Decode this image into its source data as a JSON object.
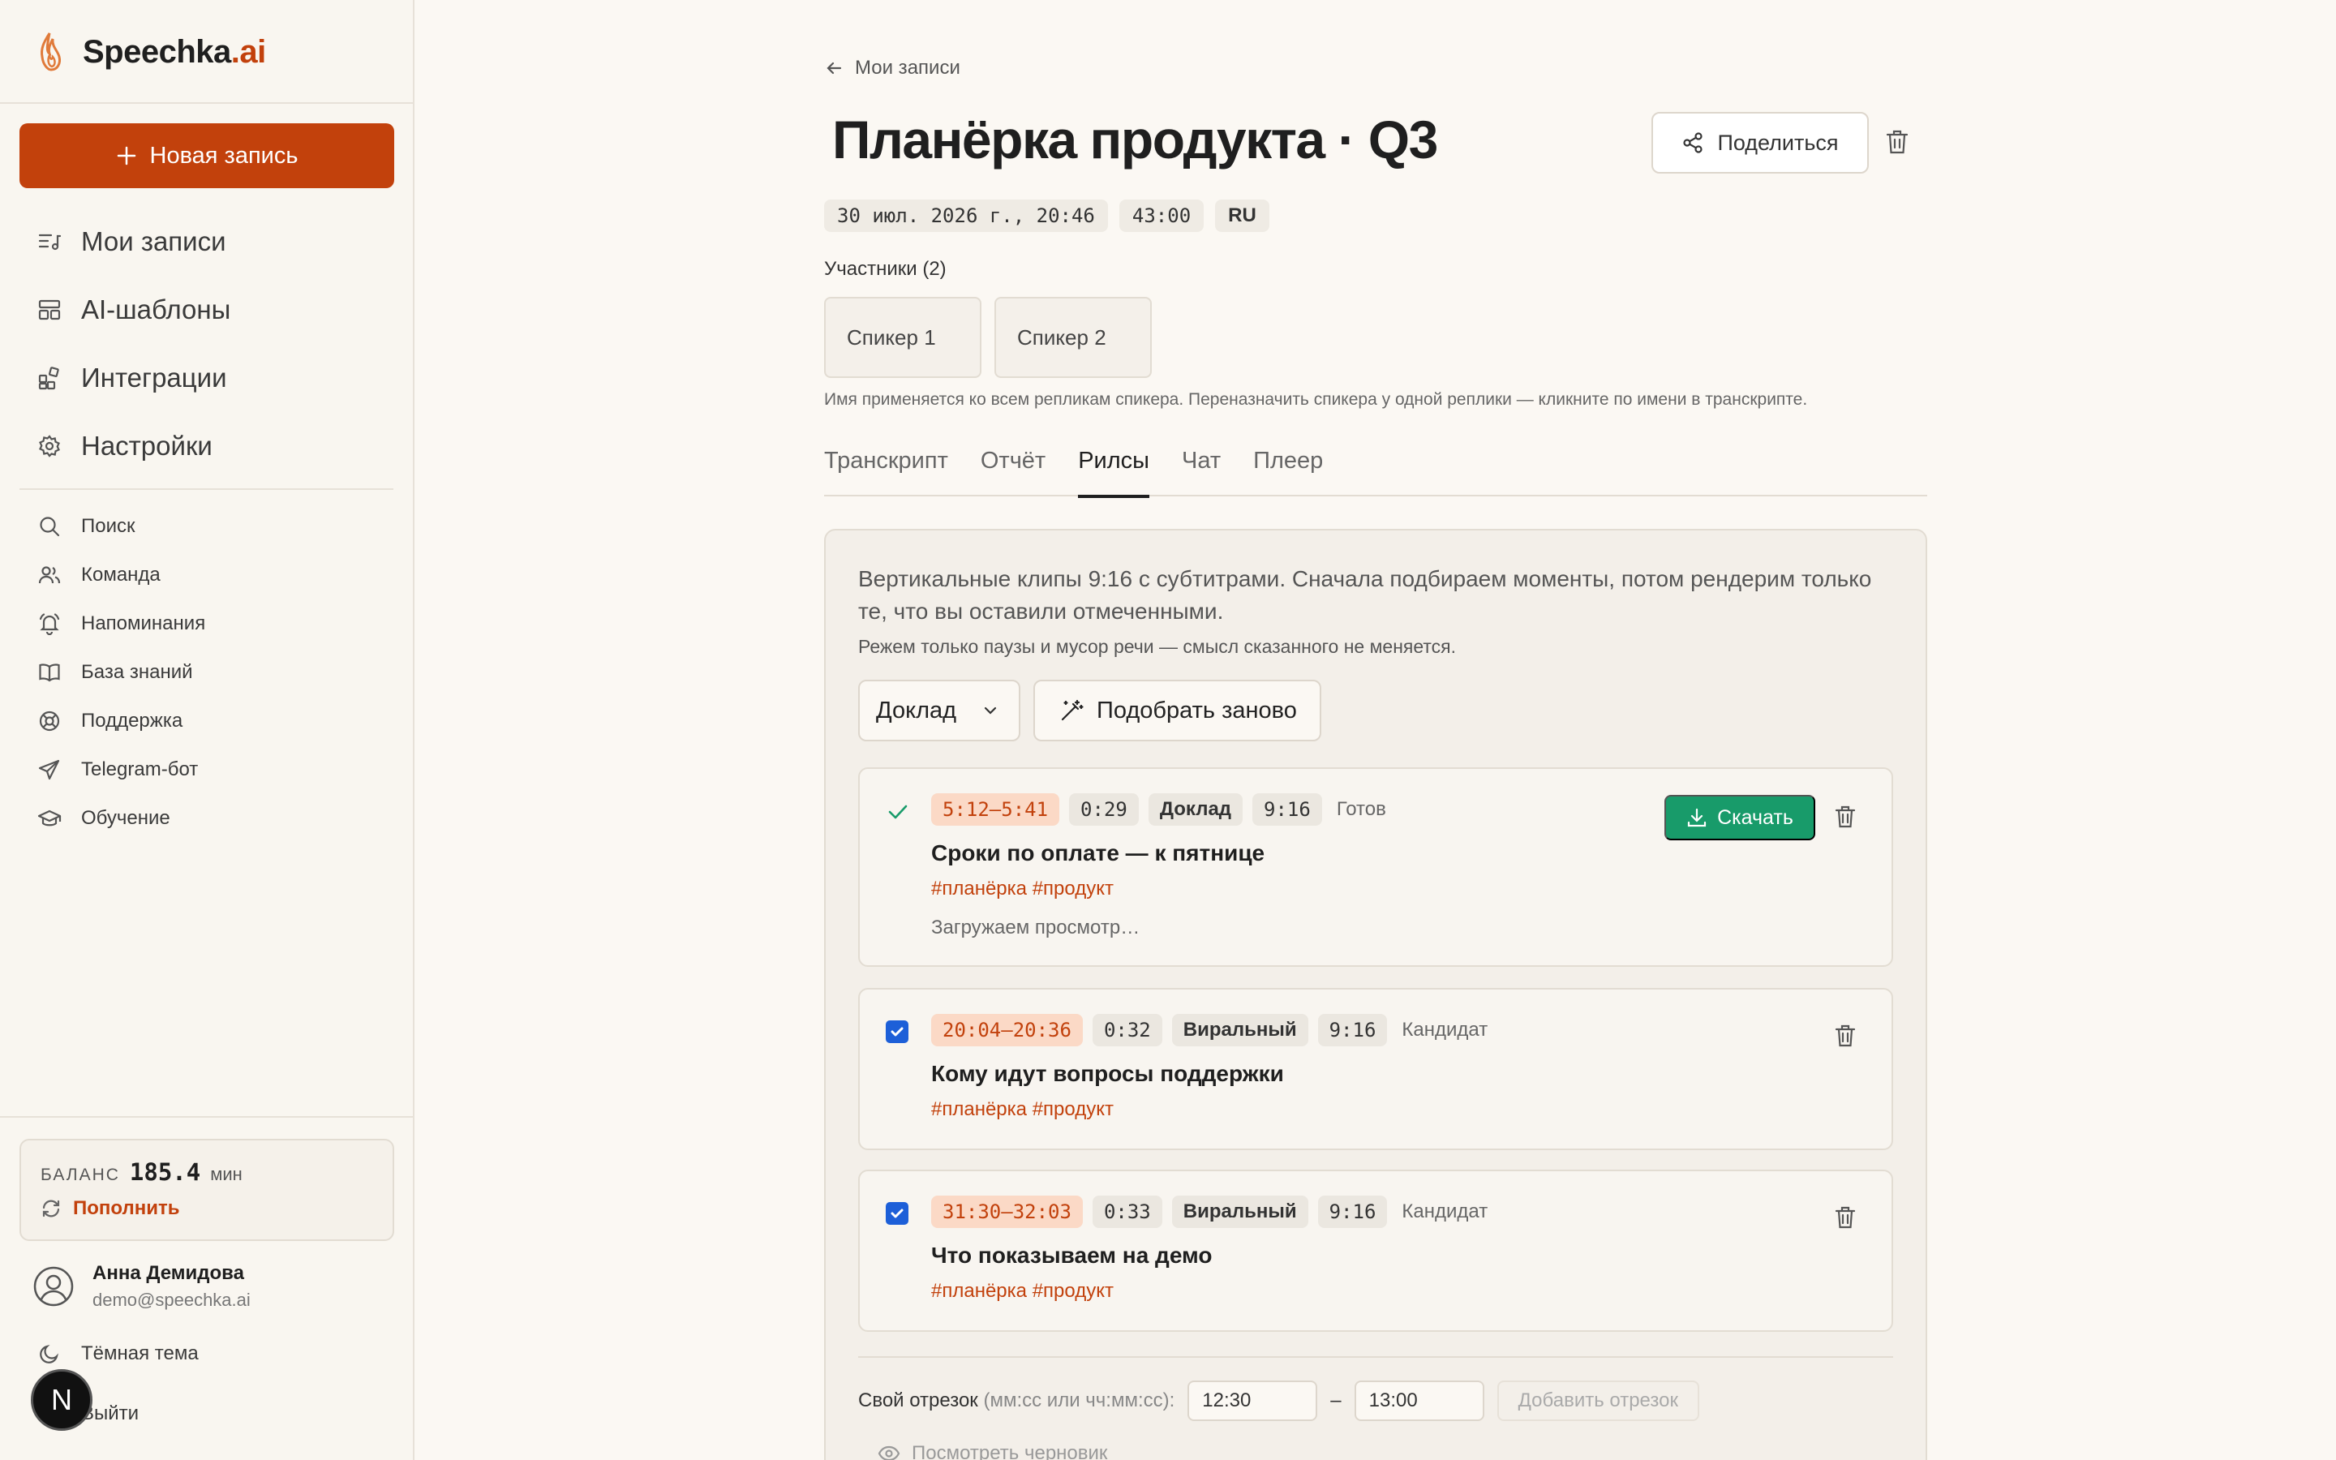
{
  "app": {
    "logo_name": "Speechka",
    "logo_ext": ".ai"
  },
  "sidebar": {
    "new_button": "Новая запись",
    "main_nav": [
      {
        "label": "Мои записи",
        "icon": "recordings-list-icon"
      },
      {
        "label": "AI-шаблоны",
        "icon": "templates-icon"
      },
      {
        "label": "Интеграции",
        "icon": "integrations-icon"
      },
      {
        "label": "Настройки",
        "icon": "gear-icon"
      }
    ],
    "sub_nav": [
      {
        "label": "Поиск",
        "icon": "search-icon"
      },
      {
        "label": "Команда",
        "icon": "team-icon"
      },
      {
        "label": "Напоминания",
        "icon": "bell-icon"
      },
      {
        "label": "База знаний",
        "icon": "book-icon"
      },
      {
        "label": "Поддержка",
        "icon": "lifebuoy-icon"
      },
      {
        "label": "Telegram-бот",
        "icon": "paper-plane-icon"
      },
      {
        "label": "Обучение",
        "icon": "graduation-cap-icon"
      }
    ],
    "balance": {
      "label": "БАЛАНС",
      "value": "185.4",
      "unit": "мин",
      "topup": "Пополнить"
    },
    "user": {
      "name": "Анна Демидова",
      "email": "demo@speechka.ai"
    },
    "theme": "Тёмная тема",
    "logout": "Выйти",
    "n_badge": "N"
  },
  "header": {
    "back": "Мои записи",
    "title": "Планёрка продукта · Q3",
    "share": "Поделиться",
    "meta": {
      "date": "30 июл. 2026 г., 20:46",
      "duration": "43:00",
      "lang": "RU"
    }
  },
  "participants": {
    "label": "Участники (2)",
    "speakers": [
      "Спикер 1",
      "Спикер 2"
    ],
    "hint": "Имя применяется ко всем репликам спикера. Переназначить спикера у одной реплики — кликните по имени в транскрипте."
  },
  "tabs": [
    "Транскрипт",
    "Отчёт",
    "Рилсы",
    "Чат",
    "Плеер"
  ],
  "active_tab": "Рилсы",
  "reels": {
    "description": "Вертикальные клипы 9:16 с субтитрами. Сначала подбираем моменты, потом рендерим только те, что вы оставили отмеченными.",
    "note": "Режем только паузы и мусор речи — смысл сказанного не меняется.",
    "mode_select": "Доклад",
    "regen_button": "Подобрать заново",
    "download_button": "Скачать",
    "clips": [
      {
        "time": "5:12–5:41",
        "duration": "0:29",
        "type": "Доклад",
        "ratio": "9:16",
        "status": "Готов",
        "title": "Сроки по оплате — к пятнице",
        "tags": "#планёрка #продукт",
        "loading": "Загружаем просмотр…"
      },
      {
        "time": "20:04–20:36",
        "duration": "0:32",
        "type": "Виральный",
        "ratio": "9:16",
        "status": "Кандидат",
        "title": "Кому идут вопросы поддержки",
        "tags": "#планёрка #продукт"
      },
      {
        "time": "31:30–32:03",
        "duration": "0:33",
        "type": "Виральный",
        "ratio": "9:16",
        "status": "Кандидат",
        "title": "Что показываем на демо",
        "tags": "#планёрка #продукт"
      }
    ],
    "custom_segment": {
      "label": "Свой отрезок",
      "format_hint": "(мм:сс или чч:мм:сс):",
      "start": "12:30",
      "separator": "–",
      "end": "13:00",
      "add_button": "Добавить отрезок"
    },
    "preview_draft": "Посмотреть черновик"
  },
  "colors": {
    "accent": "#c2410c",
    "download": "#189b6a",
    "checkbox": "#1d5fd8",
    "background": "#fbf8f3"
  }
}
